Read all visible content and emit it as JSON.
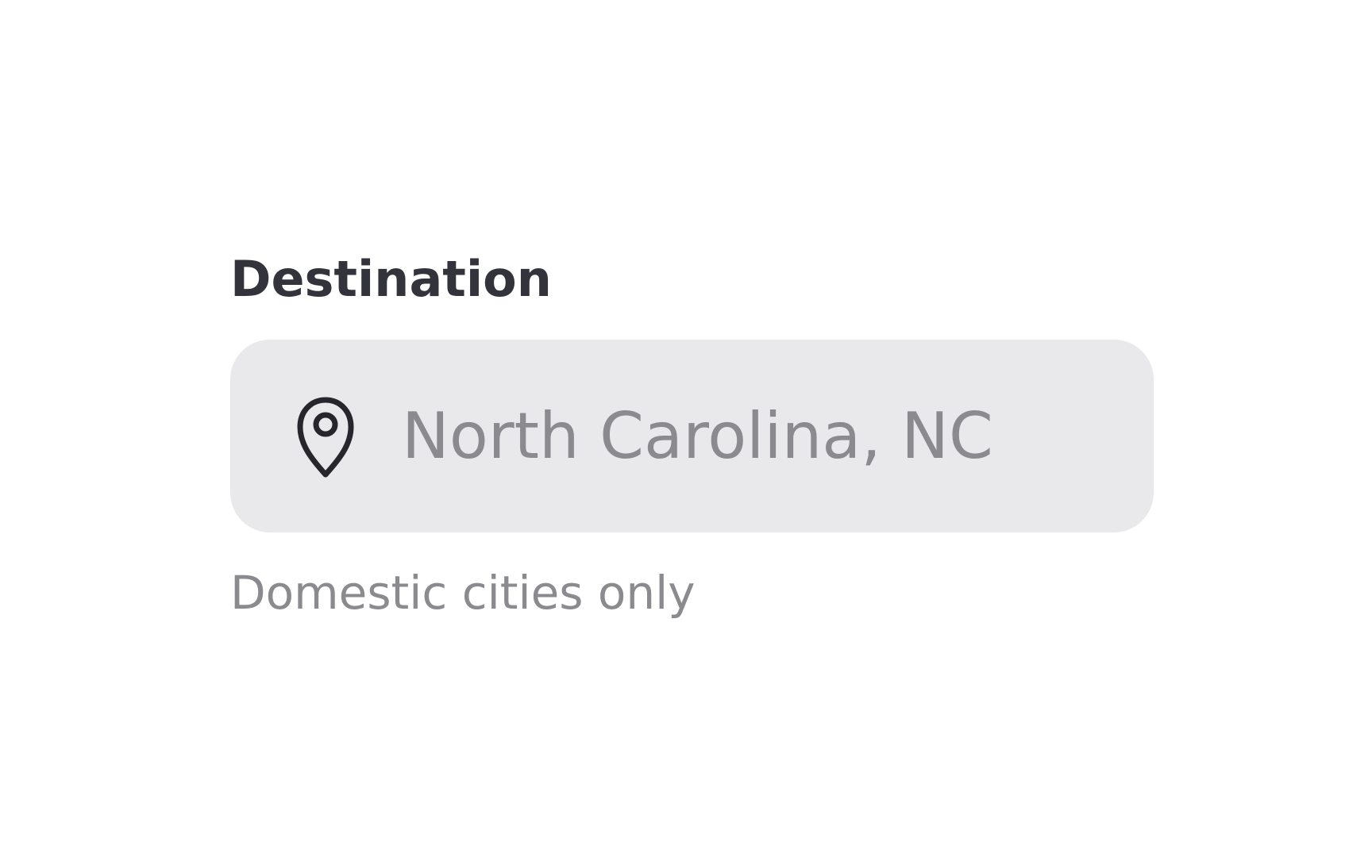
{
  "field": {
    "label": "Destination",
    "value": "North Carolina, NC",
    "helper": "Domestic cities only",
    "icon": "map-pin-icon"
  },
  "colors": {
    "label": "#33333b",
    "input_bg": "#e9e9eb",
    "input_text": "#8a8a8f",
    "helper_text": "#8a8a8f",
    "icon": "#26262c"
  }
}
